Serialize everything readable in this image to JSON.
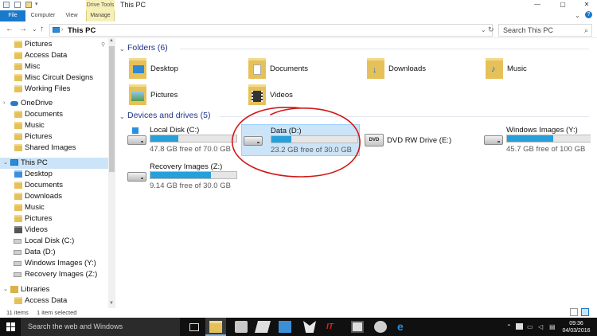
{
  "window": {
    "title": "This PC",
    "contextual_group": "Drive Tools",
    "tabs": [
      "File",
      "Computer",
      "View",
      "Manage"
    ],
    "controls": {
      "minimize": "—",
      "maximize": "▢",
      "close": "✕"
    }
  },
  "address_bar": {
    "back": "←",
    "forward": "→",
    "recent": "⌄",
    "up": "↑",
    "path": "This PC",
    "search_placeholder": "Search This PC",
    "search_icon": "⌕"
  },
  "nav_pane": {
    "quick_access": [
      "Pictures",
      "Access Data",
      "Misc",
      "Misc Circuit Designs",
      "Working Files"
    ],
    "onedrive": {
      "label": "OneDrive",
      "items": [
        "Documents",
        "Music",
        "Pictures",
        "Shared Images"
      ]
    },
    "this_pc": {
      "label": "This PC",
      "items": [
        "Desktop",
        "Documents",
        "Downloads",
        "Music",
        "Pictures",
        "Videos",
        "Local Disk (C:)",
        "Data (D:)",
        "Windows Images (Y:)",
        "Recovery Images (Z:)"
      ]
    },
    "libraries": {
      "label": "Libraries",
      "items": [
        "Access Data"
      ]
    }
  },
  "content": {
    "folders_header": "Folders (6)",
    "folders": [
      "Desktop",
      "Documents",
      "Downloads",
      "Music",
      "Pictures",
      "Videos"
    ],
    "drives_header": "Devices and drives (5)",
    "drives": [
      {
        "name": "Local Disk (C:)",
        "free": "47.8 GB free of 70.0 GB",
        "used_fraction": 0.32,
        "selected": false
      },
      {
        "name": "Data (D:)",
        "free": "23.2 GB free of 30.0 GB",
        "used_fraction": 0.23,
        "selected": true
      },
      {
        "name": "DVD RW Drive (E:)",
        "free": "",
        "used_fraction": null,
        "selected": false
      },
      {
        "name": "Windows Images (Y:)",
        "free": "45.7 GB free of 100 GB",
        "used_fraction": 0.54,
        "selected": false
      },
      {
        "name": "Recovery Images (Z:)",
        "free": "9.14 GB free of 30.0 GB",
        "used_fraction": 0.7,
        "selected": false
      }
    ],
    "dvd_badge": "DVD",
    "annotation_color": "#d01818"
  },
  "status_bar": {
    "items": "11 items",
    "selected": "1 item selected"
  },
  "taskbar": {
    "search_placeholder": "Search the web and Windows",
    "time": "09:36",
    "date": "04/03/2016"
  },
  "colors": {
    "accent": "#1979ca",
    "drive_fill": "#26a0da",
    "selection": "#cce4f7"
  }
}
